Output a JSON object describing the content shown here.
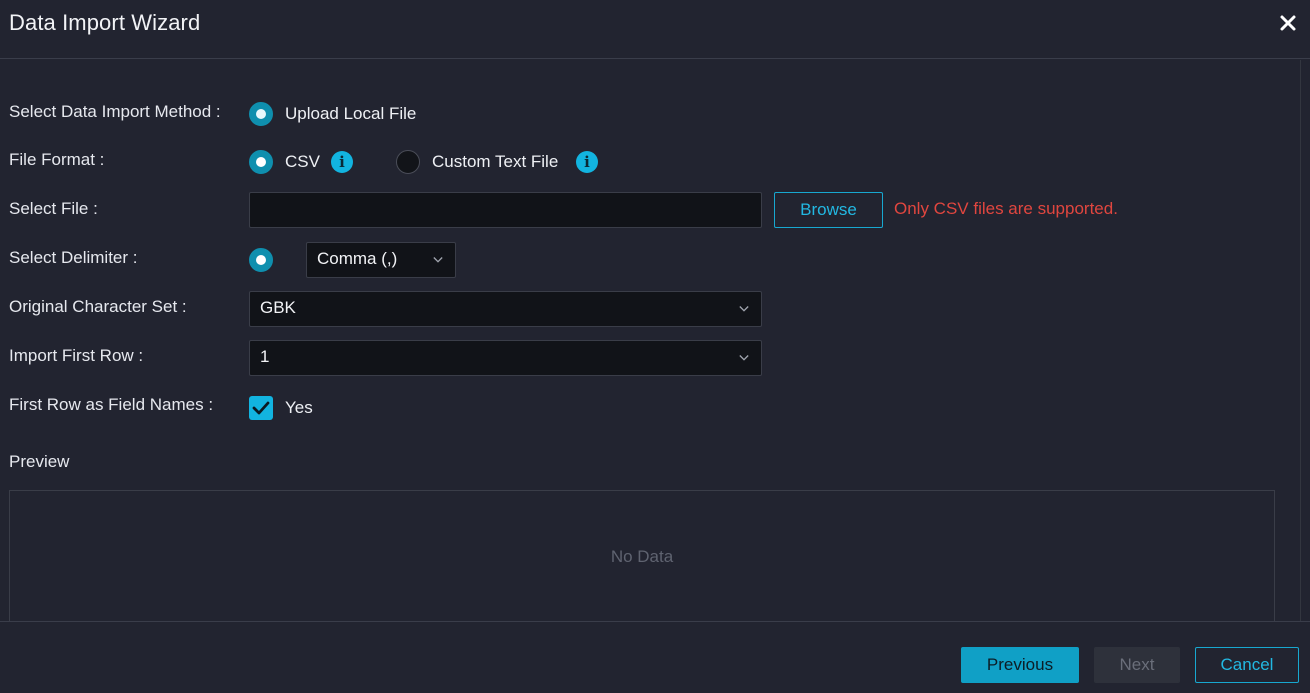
{
  "dialog": {
    "title": "Data Import Wizard"
  },
  "form": {
    "import_method": {
      "label": "Select Data Import Method :",
      "option": "Upload Local File"
    },
    "file_format": {
      "label": "File Format :",
      "options": [
        "CSV",
        "Custom Text File"
      ],
      "selected": "CSV"
    },
    "select_file": {
      "label": "Select File :",
      "value": "",
      "browse_label": "Browse",
      "error": "Only CSV files are supported."
    },
    "delimiter": {
      "label": "Select Delimiter :",
      "value": "Comma (,)"
    },
    "charset": {
      "label": "Original Character Set :",
      "value": "GBK"
    },
    "first_row": {
      "label": "Import First Row :",
      "value": "1"
    },
    "field_names": {
      "label": "First Row as Field Names :",
      "checkbox_label": "Yes",
      "checked": true
    }
  },
  "preview": {
    "label": "Preview",
    "empty_text": "No Data"
  },
  "footer": {
    "previous_label": "Previous",
    "next_label": "Next",
    "cancel_label": "Cancel"
  },
  "colors": {
    "accent": "#12b4e0",
    "error": "#e0463f",
    "background": "#222430"
  }
}
